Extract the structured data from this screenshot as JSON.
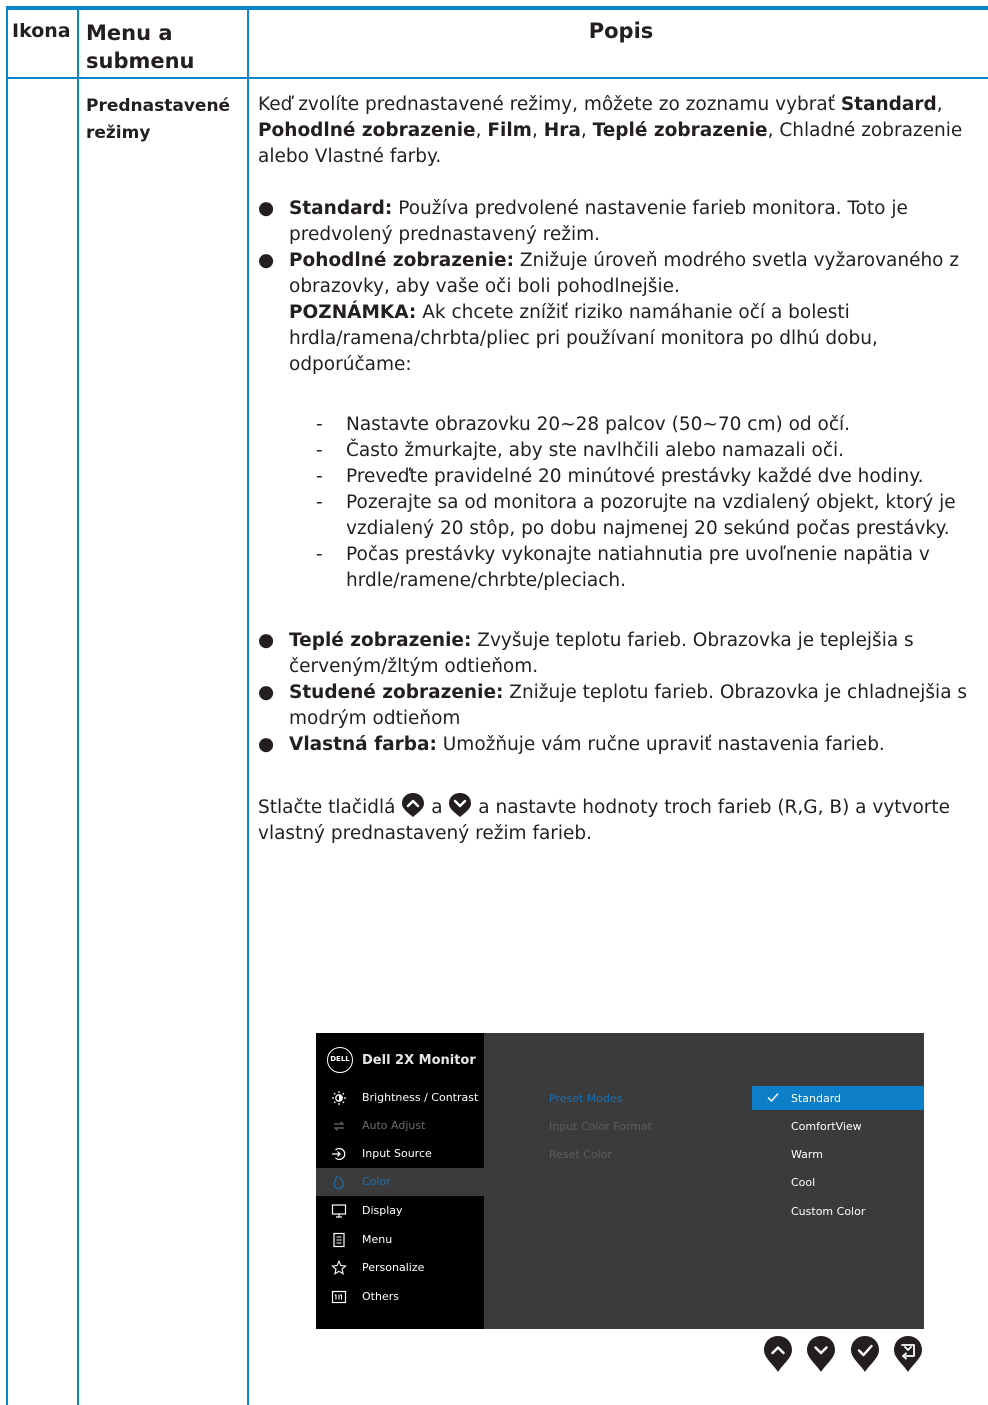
{
  "header": {
    "col_icon": "Ikona",
    "col_menu": "Menu a submenu",
    "col_desc": "Popis"
  },
  "row": {
    "submenu": "Prednastavené režimy",
    "intro": {
      "t1": "Keď zvolíte prednastavené režimy, môžete zo zoznamu vybrať ",
      "b1": "Standard",
      "t2": ", ",
      "b2": "Pohodlné zobrazenie",
      "t3": ", ",
      "b3": "Film",
      "t4": ", ",
      "b4": "Hra",
      "t5": ", ",
      "b5": "Teplé zobrazenie",
      "t6": ", Chladné zobrazenie alebo Vlastné farby."
    },
    "bullets": [
      {
        "bold": "Standard:",
        "text": " Používa predvolené nastavenie farieb monitora. Toto je predvolený prednastavený režim."
      },
      {
        "bold": "Pohodlné zobrazenie:",
        "text": " Znižuje úroveň modrého svetla vyžarovaného z obrazovky, aby vaše oči boli pohodlnejšie.",
        "note_bold": "POZNÁMKA:",
        "note_text": " Ak chcete znížiť riziko namáhanie očí a bolesti hrdla/ramena/chrbta/pliec pri používaní monitora po dlhú dobu, odporúčame:"
      },
      {
        "bold": "Teplé zobrazenie:",
        "text": " Zvyšuje teplotu farieb. Obrazovka je teplejšia s červeným/žltým odtieňom."
      },
      {
        "bold": "Studené zobrazenie:",
        "text": " Znižuje teplotu farieb. Obrazovka je chladnejšia s modrým odtieňom"
      },
      {
        "bold": "Vlastná farba:",
        "text": " Umožňuje vám ručne upraviť nastavenia farieb."
      }
    ],
    "dashes": [
      "Nastavte obrazovku 20~28 palcov (50~70 cm) od očí.",
      "Často žmurkajte, aby ste navlhčili alebo namazali oči.",
      "Preveďte pravidelné 20 minútové prestávky každé dve hodiny.",
      "Pozerajte sa od monitora a pozorujte na vzdialený objekt, ktorý je vzdialený 20 stôp, po dobu najmenej 20 sekúnd počas prestávky.",
      "Počas prestávky vykonajte natiahnutia pre uvoľnenie napätia v hrdle/ramene/chrbte/pleciach."
    ],
    "bullet_mark": "●",
    "dash_mark": "-",
    "press": {
      "t1": "Stlačte tlačidlá ",
      "t2": " a ",
      "t3": " a nastavte hodnoty troch farieb (R,G, B) a vytvorte vlastný prednastavený režim farieb."
    }
  },
  "osd": {
    "logo": "DELL",
    "title": "Dell 2X Monitor",
    "menu": [
      {
        "label": "Brightness / Contrast",
        "icon": "brightness-icon",
        "state": "normal"
      },
      {
        "label": "Auto Adjust",
        "icon": "auto-adjust-icon",
        "state": "dim"
      },
      {
        "label": "Input Source",
        "icon": "input-source-icon",
        "state": "normal"
      },
      {
        "label": "Color",
        "icon": "color-icon",
        "state": "active"
      },
      {
        "label": "Display",
        "icon": "display-icon",
        "state": "normal"
      },
      {
        "label": "Menu",
        "icon": "menu-icon",
        "state": "normal"
      },
      {
        "label": "Personalize",
        "icon": "star-icon",
        "state": "normal"
      },
      {
        "label": "Others",
        "icon": "others-icon",
        "state": "normal"
      }
    ],
    "submenu": [
      {
        "label": "Preset Modes",
        "state": "active"
      },
      {
        "label": "Input Color Format",
        "state": "dim"
      },
      {
        "label": "Reset Color",
        "state": "dim"
      }
    ],
    "options": [
      {
        "label": "Standard",
        "selected": true
      },
      {
        "label": "ComfortView",
        "selected": false
      },
      {
        "label": "Warm",
        "selected": false
      },
      {
        "label": "Cool",
        "selected": false
      },
      {
        "label": "Custom Color",
        "selected": false
      }
    ],
    "buttons": [
      "up-button-icon",
      "down-button-icon",
      "ok-button-icon",
      "back-button-icon"
    ]
  },
  "colors": {
    "rule": "#0a86c8",
    "osd_bg": "#3b3b3b",
    "osd_left": "#000000",
    "osd_selected": "#0d7fc9",
    "osd_active_text": "#1a6fb0",
    "icon_fill": "#231f20"
  }
}
